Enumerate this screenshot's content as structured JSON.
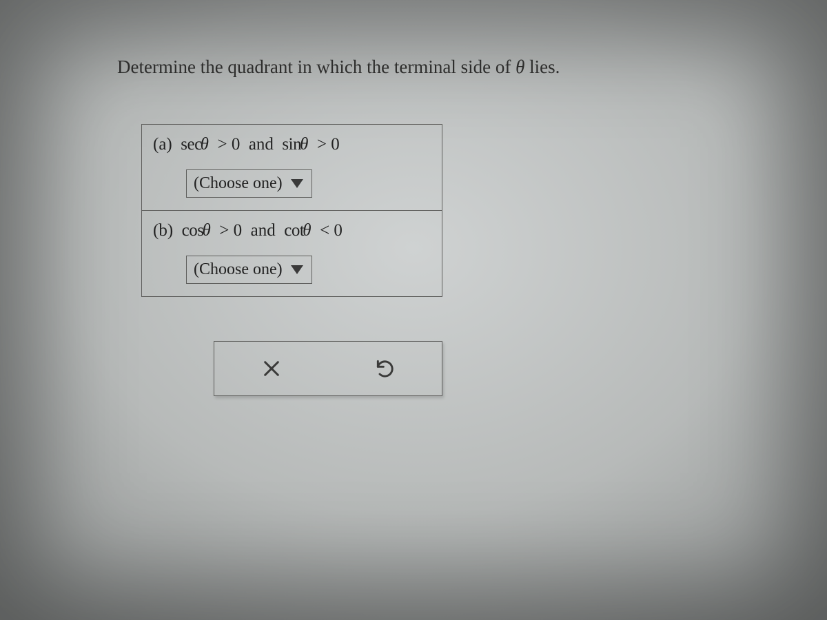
{
  "question": {
    "prefix": "Determine the quadrant in which the terminal side of ",
    "theta": "θ",
    "suffix": " lies."
  },
  "parts": {
    "a": {
      "label": "(a)",
      "fn1": "sec",
      "arg1": "θ",
      "op1": ">",
      "rhs1": "0",
      "join": "and",
      "fn2": "sin",
      "arg2": "θ",
      "op2": ">",
      "rhs2": "0",
      "dropdown": "(Choose one)"
    },
    "b": {
      "label": "(b)",
      "fn1": "cos",
      "arg1": "θ",
      "op1": ">",
      "rhs1": "0",
      "join": "and",
      "fn2": "cot",
      "arg2": "θ",
      "op2": "<",
      "rhs2": "0",
      "dropdown": "(Choose one)"
    }
  }
}
